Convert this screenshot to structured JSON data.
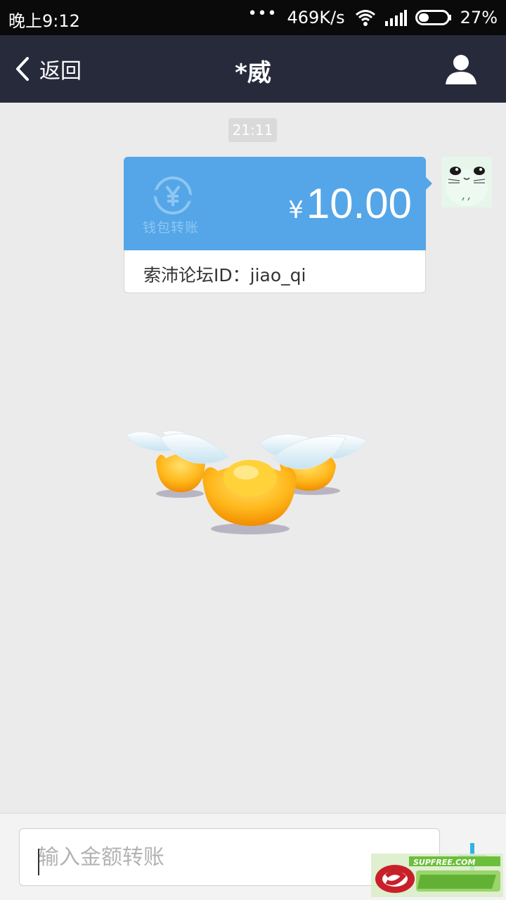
{
  "status_bar": {
    "time": "晚上9:12",
    "dots": "•••",
    "network_speed": "469K/s",
    "battery": "27%",
    "icons": [
      "wifi-icon",
      "signal-icon",
      "battery-icon"
    ]
  },
  "header": {
    "back_label": "返回",
    "title": "*威",
    "profile_icon": "person-icon"
  },
  "chat": {
    "timestamp": "21:11",
    "transfer": {
      "wallet_label": "钱包转账",
      "currency_symbol": "¥",
      "amount": "10.00",
      "note": "索沛论坛ID：jiao_qi"
    }
  },
  "input": {
    "placeholder": "输入金额转账",
    "value": "",
    "add_icon": "plus-icon"
  },
  "watermark": {
    "text": "SUPFREE.COM"
  },
  "colors": {
    "title_bar": "#272a3b",
    "card_blue": "#54a6e8",
    "background": "#ebebeb",
    "accent_plus": "#2fb3e4"
  }
}
